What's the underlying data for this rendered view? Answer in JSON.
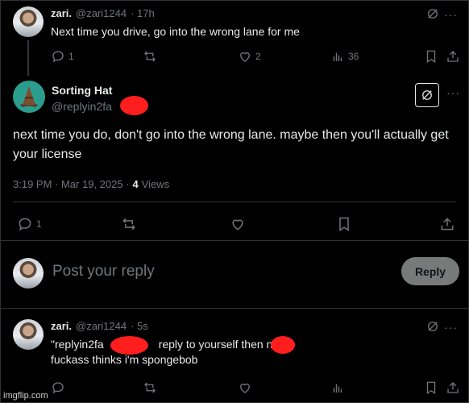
{
  "parent_tweet": {
    "name": "zari.",
    "handle": "@zari1244",
    "time": "· 17h",
    "text": "Next time you drive, go into the wrong lane for me",
    "actions": {
      "replies": "1",
      "reposts": "",
      "likes": "2",
      "views": "36"
    }
  },
  "main_tweet": {
    "name": "Sorting Hat",
    "handle": "@replyin2fa",
    "text": "next time you do, don't go into the wrong lane. maybe then you'll actually get your license",
    "timestamp": "3:19 PM · Mar 19, 2025 ·",
    "views_count": "4",
    "views_label": "Views",
    "actions": {
      "replies": "1"
    }
  },
  "composer": {
    "placeholder": "Post your reply",
    "button_label": "Reply"
  },
  "reply_tweet": {
    "name": "zari.",
    "handle": "@zari1244",
    "time": "· 5s",
    "text_line1_a": "\"replyin2fa",
    "text_line1_b": "reply to yourself then n",
    "text_line2": "fuckass thinks i'm spongebob"
  },
  "watermark": "imgflip.com",
  "colors": {
    "background": "#000000",
    "text": "#e7e9ea",
    "muted": "#71767b",
    "redaction": "#ff1e1e"
  }
}
